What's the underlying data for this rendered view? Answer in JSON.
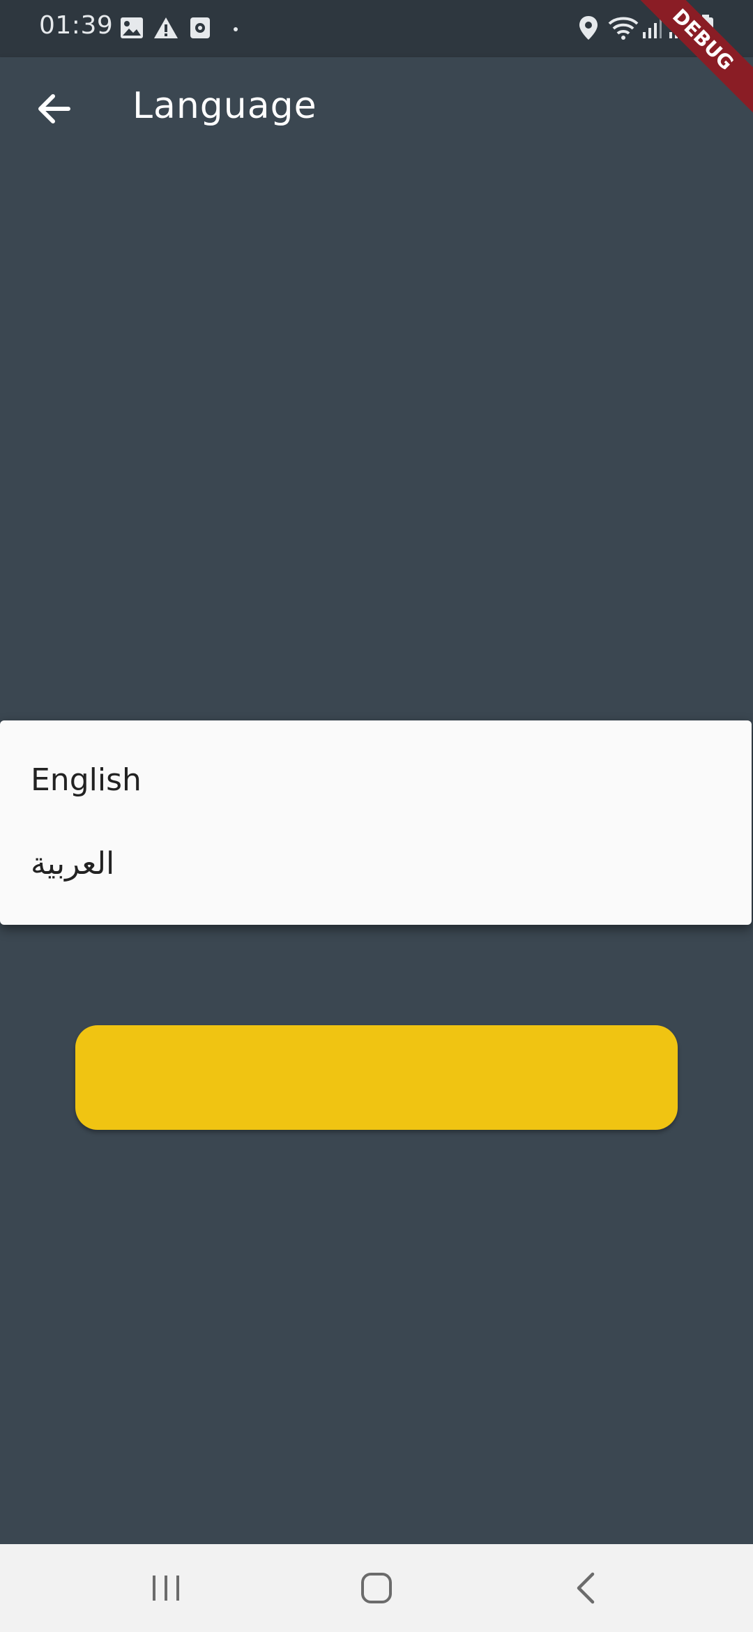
{
  "status_bar": {
    "time": "01:39",
    "left_icons": [
      "image-icon",
      "warning-icon",
      "voice-recorder-icon",
      "dot-icon"
    ],
    "right_icons": [
      "location-icon",
      "wifi-icon",
      "signal-icon",
      "signal-icon",
      "battery-icon"
    ]
  },
  "debug_banner": "DEBUG",
  "app_bar": {
    "back_icon": "arrow-left-icon",
    "title": "Language"
  },
  "menu": {
    "items": [
      {
        "label": "English"
      },
      {
        "label": "العربية"
      }
    ]
  },
  "nav_bar": {
    "icons": [
      "recent-apps-icon",
      "home-icon",
      "back-icon"
    ]
  },
  "colors": {
    "background": "#3b4751",
    "status_bar": "#2e373f",
    "accent": "#f0c412",
    "menu_surface": "#fafafa",
    "debug_ribbon": "#8a1d25",
    "nav_bar": "#f2f2f2"
  }
}
